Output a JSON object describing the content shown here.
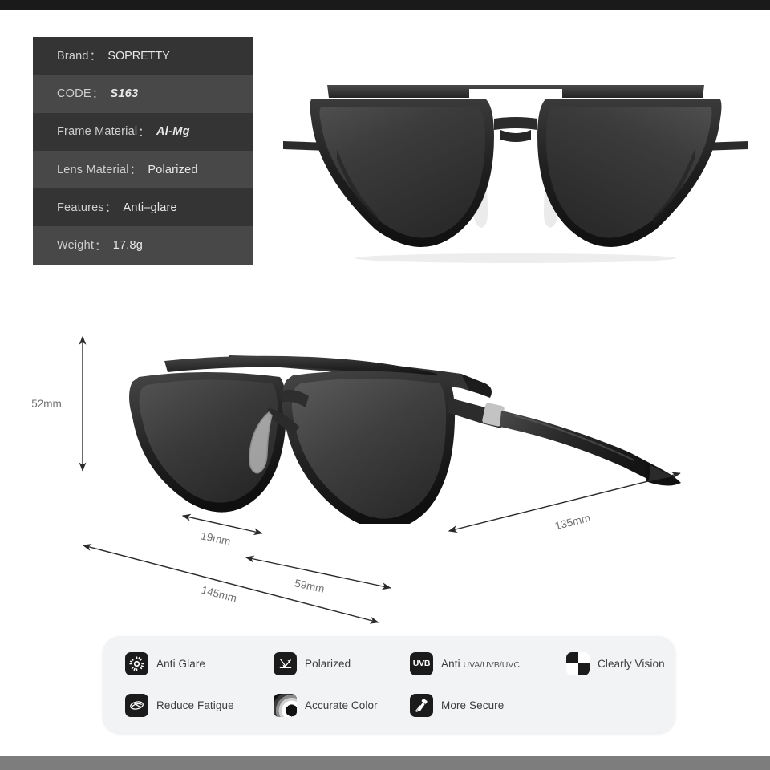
{
  "product": {
    "brand": "SOPRETTY",
    "code": "S163"
  },
  "spec_table": {
    "rows": [
      {
        "label": "Brand",
        "colon": "：",
        "value": "SOPRETTY",
        "style": "plain"
      },
      {
        "label": "CODE",
        "colon": "：",
        "value": "S163",
        "style": "bold-italic"
      },
      {
        "label": "Frame Material",
        "colon": "：",
        "value": "Al-Mg",
        "style": "bold-italic"
      },
      {
        "label": "Lens Material",
        "colon": "：",
        "value": "Polarized",
        "style": "plain"
      },
      {
        "label": "Features",
        "colon": "：",
        "value": "Anti–glare",
        "style": "plain"
      },
      {
        "label": "Weight",
        "colon": "：",
        "value": "17.8g",
        "style": "plain"
      }
    ]
  },
  "dimensions": {
    "height": "52mm",
    "bridge": "19mm",
    "lens_width": "59mm",
    "total_width": "145mm",
    "temple_length": "135mm"
  },
  "features": [
    {
      "id": "anti-glare",
      "icon": "sun-burst-icon",
      "label": "Anti Glare",
      "sub": ""
    },
    {
      "id": "polarized",
      "icon": "light-rays-icon",
      "label": "Polarized",
      "sub": ""
    },
    {
      "id": "anti-uv",
      "icon": "uvb-badge-icon",
      "label": "Anti",
      "sub": "UVA/UVB/UVC"
    },
    {
      "id": "clearly-vision",
      "icon": "checkerboard-icon",
      "label": "Clearly Vision",
      "sub": ""
    },
    {
      "id": "reduce-fatigue",
      "icon": "eye-icon",
      "label": "Reduce Fatigue",
      "sub": ""
    },
    {
      "id": "accurate-color",
      "icon": "color-ring-icon",
      "label": "Accurate Color",
      "sub": ""
    },
    {
      "id": "more-secure",
      "icon": "hammer-icon",
      "label": "More Secure",
      "sub": ""
    }
  ],
  "colors": {
    "spec_row_dark": "#343434",
    "spec_row_light": "#484848",
    "spec_text": "#d4d4d4",
    "panel_background": "#f2f3f5",
    "icon_background": "#1b1b1b",
    "top_bar": "#1a1a1a",
    "bottom_bar": "#7d7d7d",
    "dimension_line": "#2a2a2a",
    "dimension_label": "#6f6f6f"
  }
}
